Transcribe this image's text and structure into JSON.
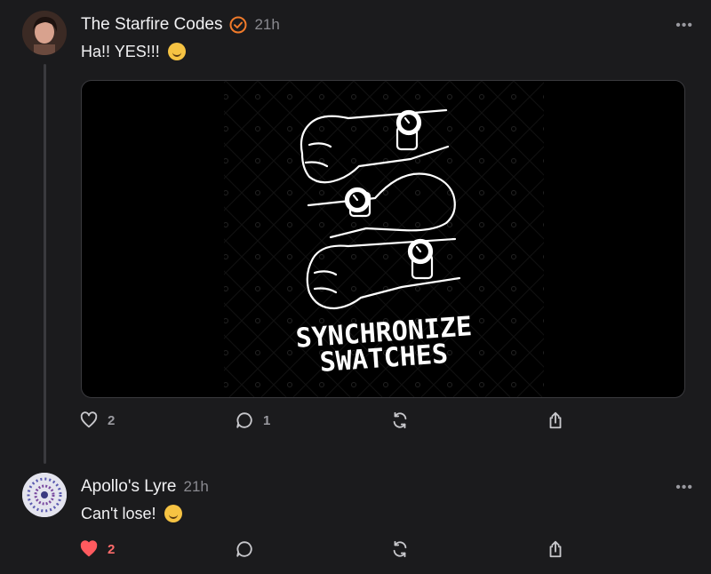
{
  "posts": [
    {
      "author": "The Starfire Codes",
      "verified": true,
      "time": "21h",
      "text": "Ha!! YES!!!",
      "emoji": "rolling-on-floor-laughing",
      "media": {
        "headline_line1": "SYNCHRONIZE",
        "headline_line2": "SWATCHES"
      },
      "actions": {
        "likes": "2",
        "replies": "1",
        "liked": false
      }
    },
    {
      "author": "Apollo's Lyre",
      "verified": false,
      "time": "21h",
      "text": "Can't lose!",
      "emoji": "grinning-face",
      "actions": {
        "likes": "2",
        "replies": "",
        "liked": true
      }
    }
  ],
  "colors": {
    "background": "#1b1b1d",
    "verified": "#f07a2a",
    "liked": "#ff5a5f",
    "muted": "#8a8a90"
  }
}
